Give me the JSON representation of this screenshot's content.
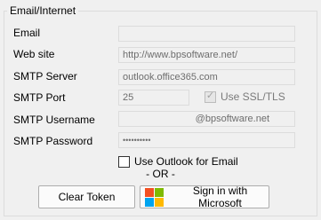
{
  "group": {
    "title": "Email/Internet"
  },
  "fields": {
    "email": {
      "label": "Email",
      "value": ""
    },
    "website": {
      "label": "Web site",
      "value": "http://www.bpsoftware.net/"
    },
    "smtp_server": {
      "label": "SMTP Server",
      "value": "outlook.office365.com"
    },
    "smtp_port": {
      "label": "SMTP Port",
      "value": "25"
    },
    "use_ssl": {
      "label": "Use SSL/TLS",
      "checked": true,
      "enabled": false
    },
    "smtp_username": {
      "label": "SMTP Username",
      "value": "@bpsoftware.net"
    },
    "smtp_password": {
      "label": "SMTP Password",
      "value": "••••••••••"
    }
  },
  "use_outlook": {
    "label": "Use Outlook for Email",
    "checked": false
  },
  "or_text": "- OR -",
  "buttons": {
    "clear_token": "Clear Token",
    "sign_in": "Sign in with Microsoft"
  },
  "icons": {
    "microsoft_logo": "microsoft-logo-icon",
    "checkmark": "checkmark-icon"
  },
  "colors": {
    "ms_red": "#f25022",
    "ms_green": "#7fba00",
    "ms_blue": "#00a4ef",
    "ms_yellow": "#ffb900"
  }
}
